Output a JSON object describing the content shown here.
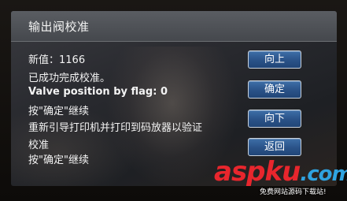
{
  "screen": {
    "title": "输出阀校准",
    "messages": [
      "新值：1166",
      "已成功完成校准。",
      "Valve position by flag: 0",
      "按\"确定\"继续",
      "重新引导打印机并打印到码放器以验证",
      "校准",
      "按\"确定\"继续"
    ]
  },
  "buttons": {
    "up": "向上",
    "ok": "确定",
    "down": "向下",
    "back": "返回"
  },
  "watermark": {
    "brand_main": "aspku",
    "brand_tld": ".com",
    "tagline": "免费网站源码下载站!"
  },
  "colors": {
    "button_blue": "#2a5288",
    "watermark_red": "#e8262d",
    "watermark_blue": "#2fa3e0"
  }
}
